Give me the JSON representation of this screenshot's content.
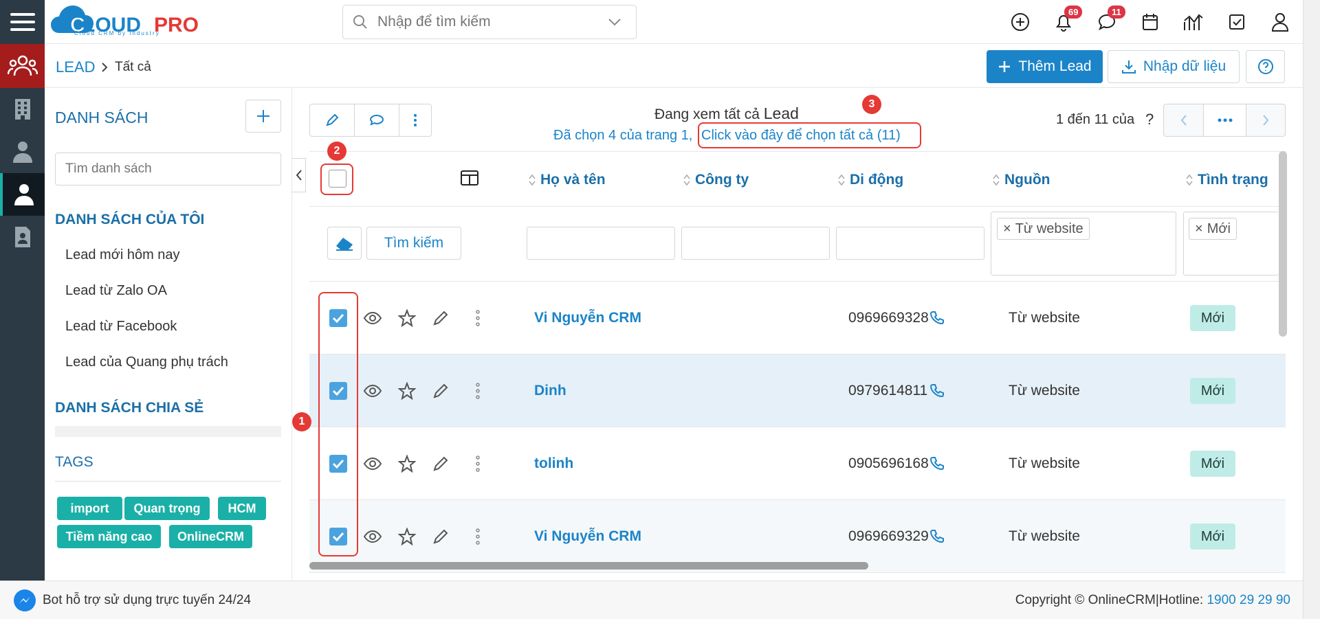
{
  "app": {
    "logo_text": "CLOUDPRO",
    "logo_tagline": "Cloud CRM by Industry"
  },
  "search": {
    "placeholder": "Nhập để tìm kiếm"
  },
  "header": {
    "notifications_count": "69",
    "messages_count": "11"
  },
  "breadcrumb": {
    "module": "LEAD",
    "view": "Tất cả"
  },
  "actions": {
    "add_lead": "Thêm Lead",
    "import": "Nhập dữ liệu"
  },
  "sidebar": {
    "lists_title": "DANH SÁCH",
    "search_placeholder": "Tìm danh sách",
    "my_lists_title": "DANH SÁCH CỦA TÔI",
    "my_lists": [
      "Lead mới hôm nay",
      "Lead từ Zalo OA",
      "Lead từ Facebook",
      "Lead của Quang phụ trách"
    ],
    "shared_title": "DANH SÁCH CHIA SẺ",
    "tags_title": "TAGS",
    "tags": [
      "import",
      "Quan trọng",
      "HCM",
      "Tiềm năng cao",
      "OnlineCRM"
    ]
  },
  "listview": {
    "viewing_prefix": "Đang xem tất cả",
    "viewing_module": "Lead",
    "selected_text": "Đã chọn 4 của trang 1,",
    "select_all_link": "Click vào đây để chọn tất cả (11)",
    "pagination": "1 đến 11 của",
    "pagination_unknown": "?",
    "columns": [
      "Họ và tên",
      "Công ty",
      "Di động",
      "Nguồn",
      "Tình trạng"
    ],
    "search_button": "Tìm kiếm",
    "filter_source_chip": "Từ website",
    "filter_status_chip": "Mới",
    "rows": [
      {
        "name": "Vi Nguyễn CRM",
        "company": "",
        "mobile": "0969669328",
        "source": "Từ website",
        "status": "Mới",
        "checked": true
      },
      {
        "name": "Dinh",
        "company": "",
        "mobile": "0979614811",
        "source": "Từ website",
        "status": "Mới",
        "checked": true
      },
      {
        "name": "tolinh",
        "company": "",
        "mobile": "0905696168",
        "source": "Từ website",
        "status": "Mới",
        "checked": true
      },
      {
        "name": "Vi Nguyễn CRM",
        "company": "",
        "mobile": "0969669329",
        "source": "Từ website",
        "status": "Mới",
        "checked": true
      }
    ]
  },
  "annotations": [
    "1",
    "2",
    "3"
  ],
  "footer": {
    "bot_text": "Bot hỗ trợ sử dụng trực tuyến 24/24",
    "copyright": "Copyright © OnlineCRM",
    "hotline_label": "Hotline:",
    "hotline_number": "1900 29 29 90"
  },
  "colors": {
    "primary": "#1b84c8",
    "rail": "#2b3a45",
    "rail_active": "#a51c1c",
    "tag": "#1ab0a8",
    "status": "#bfece6",
    "annotation": "#e53935"
  }
}
